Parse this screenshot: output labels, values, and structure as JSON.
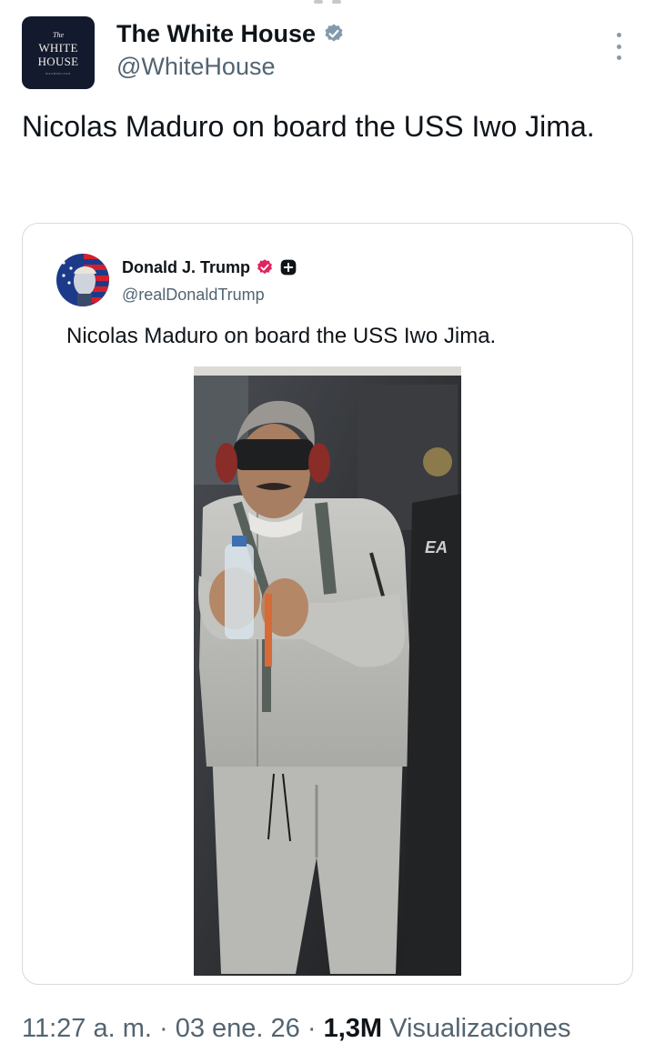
{
  "tweet": {
    "author": {
      "display_name": "The White House",
      "handle": "@WhiteHouse",
      "avatar_logo": {
        "the": "The",
        "line1": "WHITE",
        "line2": "HOUSE",
        "sub": "WASHINGTON"
      },
      "verified": true,
      "verified_icon": "verified-badge-icon"
    },
    "text": "Nicolas Maduro on board the USS Iwo Jima.",
    "more_icon": "more-options-icon"
  },
  "quoted": {
    "author": {
      "display_name": "Donald J. Trump",
      "handle": "@realDonaldTrump",
      "verified_icon": "verified-badge-icon",
      "affiliate_icon": "plus-badge-icon"
    },
    "text": "Nicolas Maduro on board the USS Iwo Jima.",
    "photo_icon": "photo"
  },
  "footer": {
    "time": "11:27 a. m.",
    "separator1": " · ",
    "date": "03 ene. 26",
    "separator2": " · ",
    "views_count": "1,3M",
    "views_label": " Visualizaciones"
  },
  "colors": {
    "verified_blue": "#829aab",
    "trump_badge": "#e0245e",
    "text_primary": "#0f1419",
    "text_secondary": "#536471",
    "card_border": "#d6dbe0"
  }
}
